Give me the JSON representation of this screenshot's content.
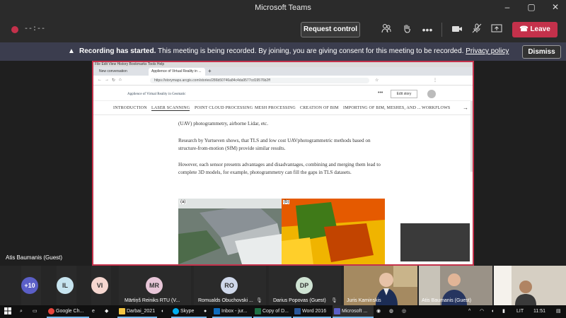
{
  "app": {
    "title": "Microsoft Teams"
  },
  "window_controls": {
    "min": "–",
    "max": "▢",
    "close": "✕"
  },
  "toolbar": {
    "timer": "--:--",
    "request_control": "Request control",
    "leave": "Leave"
  },
  "banner": {
    "bold": "Recording has started.",
    "text": "This meeting is being recorded. By joining, you are giving consent for this meeting to be recorded.",
    "link": "Privacy policy",
    "dismiss": "Dismiss"
  },
  "shared": {
    "menu": "File  Edit  View  History  Bookmarks  Tools  Help",
    "tabs": [
      "New conversation",
      "Applience of Virtual Reality in ..."
    ],
    "url": "https://storymaps.arcgis.com/stories/286b50746a84c4da9577cd19576b2ff",
    "story_title": "Applience of Virtual Reality in Geomatic",
    "edit_story": "Edit story",
    "nav": [
      "INTRODUCTION",
      "LASER SCANNING",
      "POINT CLOUD PROCESSING",
      "MESH PROCESSING",
      "CREATION OF BIM",
      "IMPORTING OF BIM, MESHES, AND ...",
      "WORKFLOWS"
    ],
    "paragraphs": [
      "(UAV) photogrammetry, airborne Lidar, etc.",
      "Research by Yurtseven shows, that TLS and low cost UAVphotogrammetric methods based on structure-from-motion (SfM) provide similar results.",
      "However, each sensor presents advantages and disadvantages, combining and merging them lead to complete 3D models, for example, photogrammetry can fill the gaps in TLS datasets."
    ],
    "image_labels": [
      "(a)",
      "(b)"
    ]
  },
  "presenter": "Atis Baumanis (Guest)",
  "participants": [
    {
      "initials": "+10",
      "color": "#5b5fc7",
      "text_color": "#ffffff"
    },
    {
      "initials": "IL",
      "color": "#c7e4ef"
    },
    {
      "initials": "VI",
      "color": "#f6d7d0"
    },
    {
      "initials": "MR",
      "color": "#e8c6d8",
      "name": "Mārtiņš Reiniks RTU (V..."
    },
    {
      "initials": "RO",
      "color": "#cfd8ea",
      "name": "Romualds Obuchovski ..."
    },
    {
      "initials": "DP",
      "color": "#cfe3d3",
      "name": "Darius Popovas (Guest)"
    }
  ],
  "video_tiles": [
    {
      "name": "Juris Kaminskis"
    },
    {
      "name": "Atis Baumanis (Guest)"
    },
    {
      "name": ""
    }
  ],
  "taskbar": {
    "items": [
      "Google Ch...",
      "Darbai_2021",
      "Skype",
      "Inbox - jur...",
      "Copy of D...",
      "Word 2016",
      "Microsoft ..."
    ],
    "lang": "LIT",
    "time": "11:51"
  }
}
